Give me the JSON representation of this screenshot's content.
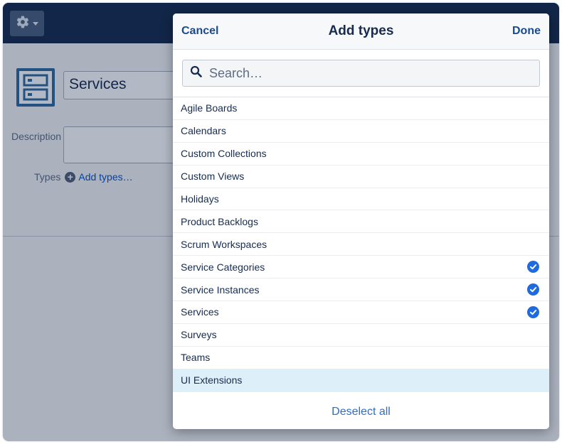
{
  "background": {
    "name_value": "Services",
    "description_label": "Description",
    "types_label": "Types",
    "add_types_link": "Add types…"
  },
  "modal": {
    "title": "Add types",
    "cancel_label": "Cancel",
    "done_label": "Done",
    "search_placeholder": "Search…",
    "items": [
      {
        "label": "Agile Boards",
        "selected": false
      },
      {
        "label": "Calendars",
        "selected": false
      },
      {
        "label": "Custom Collections",
        "selected": false
      },
      {
        "label": "Custom Views",
        "selected": false
      },
      {
        "label": "Holidays",
        "selected": false
      },
      {
        "label": "Product Backlogs",
        "selected": false
      },
      {
        "label": "Scrum Workspaces",
        "selected": false
      },
      {
        "label": "Service Categories",
        "selected": true
      },
      {
        "label": "Service Instances",
        "selected": true
      },
      {
        "label": "Services",
        "selected": true
      },
      {
        "label": "Surveys",
        "selected": false
      },
      {
        "label": "Teams",
        "selected": false
      },
      {
        "label": "UI Extensions",
        "selected": false,
        "highlighted": true
      }
    ],
    "deselect_all_label": "Deselect all"
  },
  "colors": {
    "topbar": "#172b4d",
    "accent_blue": "#1d6bde",
    "link_blue": "#2d6ec8",
    "highlight_row": "#ddeff9"
  },
  "icons": {
    "settings": "gear-icon",
    "dropdown": "caret-down-icon",
    "app": "server-rack-icon",
    "search": "search-icon",
    "add": "plus-circle-icon",
    "selected": "check-circle-icon"
  }
}
